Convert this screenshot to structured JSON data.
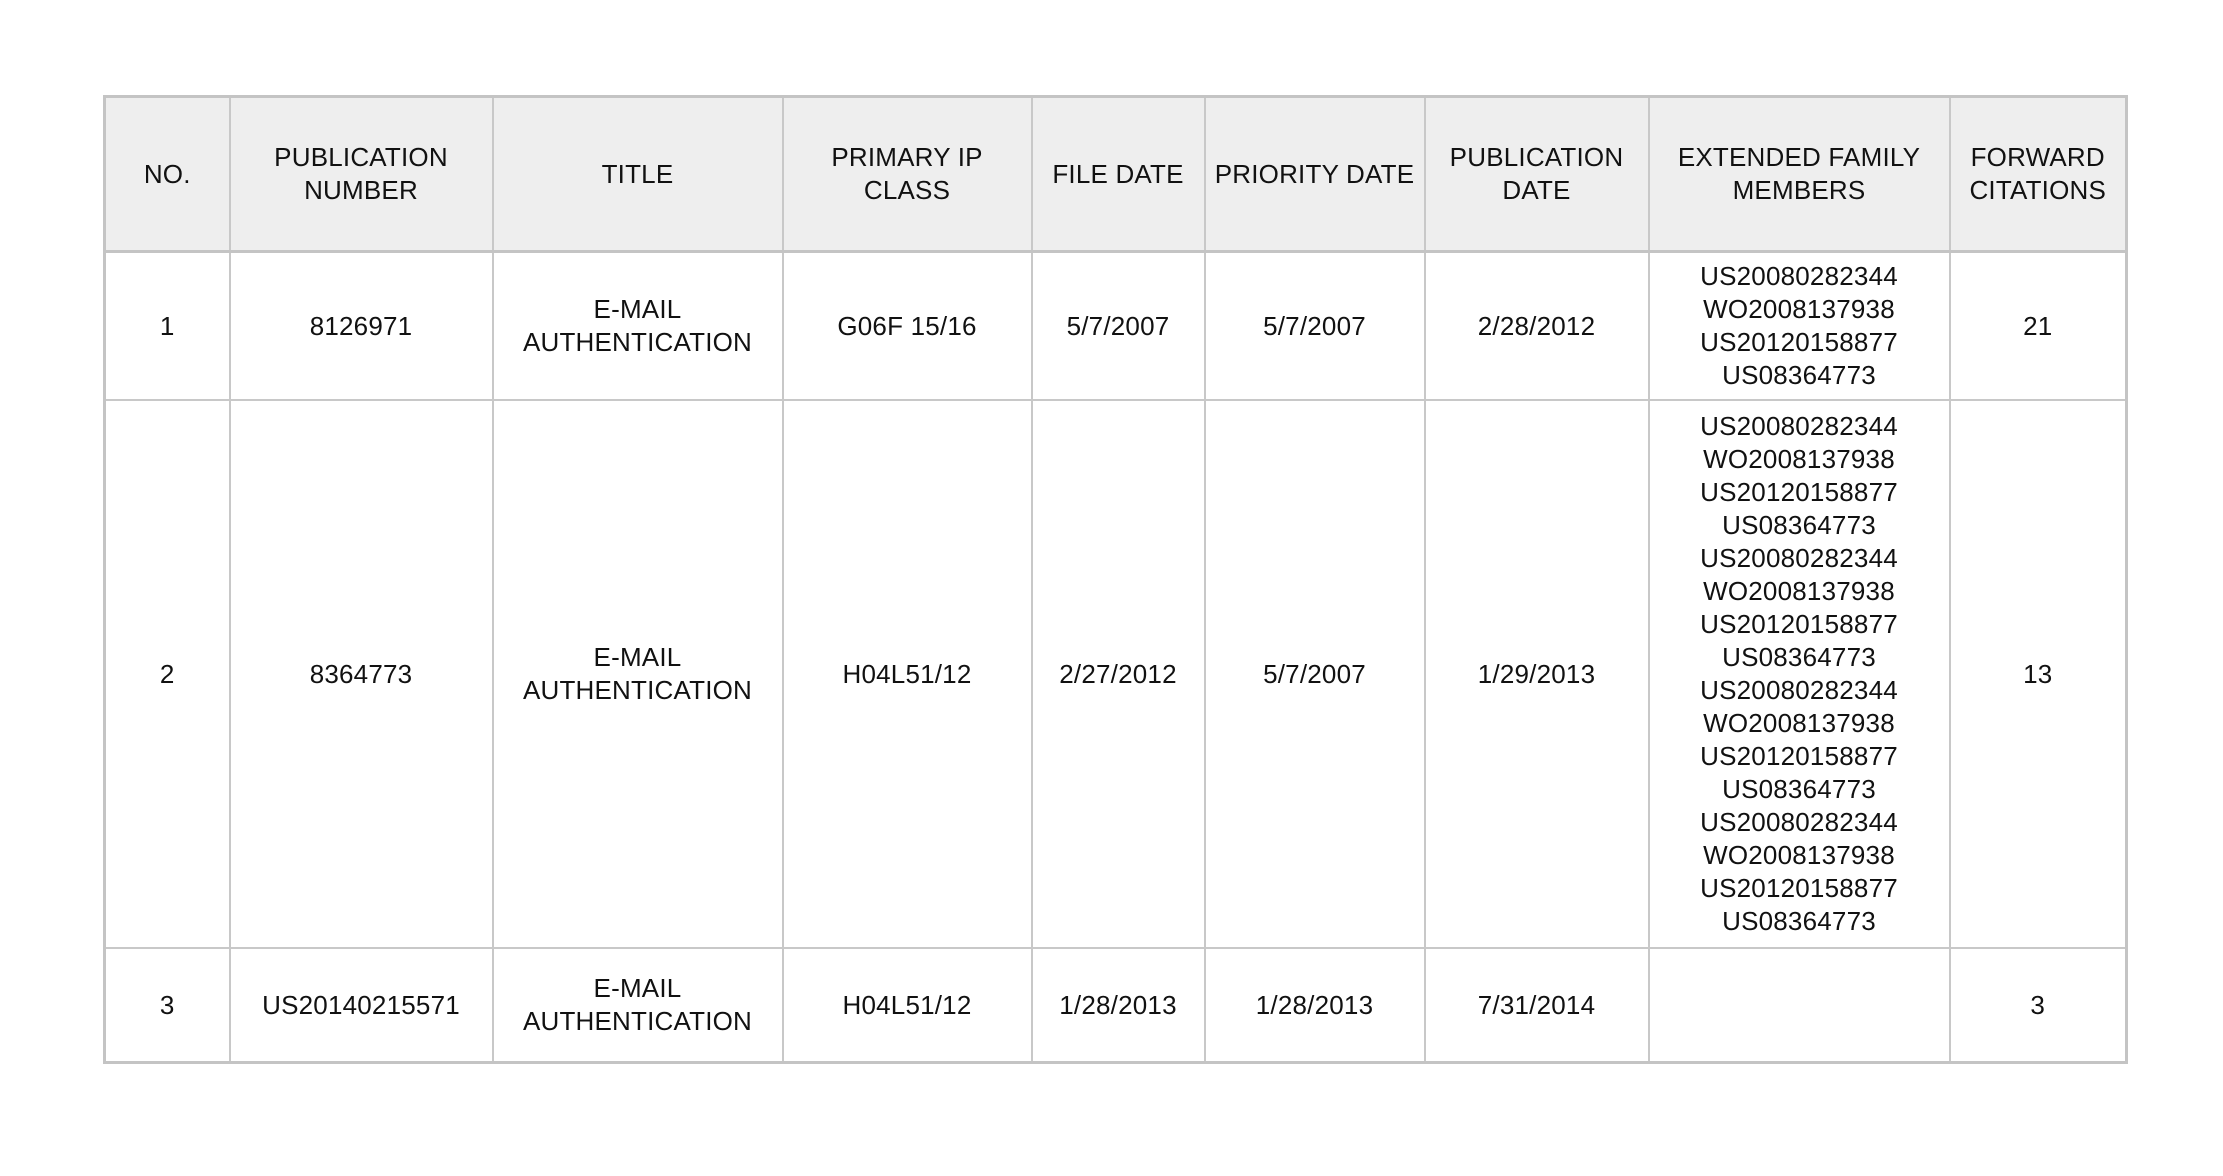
{
  "table": {
    "headers": [
      "NO.",
      "PUBLICATION NUMBER",
      "TITLE",
      "PRIMARY IP CLASS",
      "FILE DATE",
      "PRIORITY DATE",
      "PUBLICATION DATE",
      "EXTENDED FAMILY MEMBERS",
      "FORWARD CITATIONS"
    ],
    "rows": [
      {
        "no": "1",
        "publication_number": "8126971",
        "title": "E-MAIL AUTHENTICATION",
        "primary_ip_class": "G06F 15/16",
        "file_date": "5/7/2007",
        "priority_date": "5/7/2007",
        "publication_date": "2/28/2012",
        "extended_family_members": [
          "US20080282344",
          "WO2008137938",
          "US20120158877",
          "US08364773"
        ],
        "forward_citations": "21"
      },
      {
        "no": "2",
        "publication_number": "8364773",
        "title": "E-MAIL AUTHENTICATION",
        "primary_ip_class": "H04L51/12",
        "file_date": "2/27/2012",
        "priority_date": "5/7/2007",
        "publication_date": "1/29/2013",
        "extended_family_members": [
          "US20080282344",
          "WO2008137938",
          "US20120158877",
          "US08364773",
          "US20080282344",
          "WO2008137938",
          "US20120158877",
          "US08364773",
          "US20080282344",
          "WO2008137938",
          "US20120158877",
          "US08364773",
          "US20080282344",
          "WO2008137938",
          "US20120158877",
          "US08364773"
        ],
        "forward_citations": "13"
      },
      {
        "no": "3",
        "publication_number": "US20140215571",
        "title": "E-MAIL AUTHENTICATION",
        "primary_ip_class": "H04L51/12",
        "file_date": "1/28/2013",
        "priority_date": "1/28/2013",
        "publication_date": "7/31/2014",
        "extended_family_members": [],
        "forward_citations": "3"
      }
    ]
  }
}
